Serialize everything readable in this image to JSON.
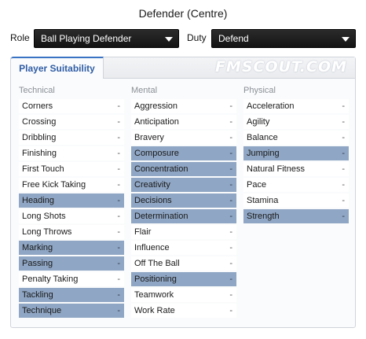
{
  "header": {
    "title": "Defender (Centre)"
  },
  "selectors": {
    "role_label": "Role",
    "role_value": "Ball Playing Defender",
    "duty_label": "Duty",
    "duty_value": "Defend"
  },
  "panel": {
    "tab_label": "Player Suitability",
    "watermark": "FMSCOUT.COM"
  },
  "colors": {
    "highlight": "#8fa6c4",
    "tab_accent": "#3a73c4",
    "select_bg": "#1c1c1c"
  },
  "technical": {
    "heading": "Technical",
    "items": [
      {
        "name": "Corners",
        "value": "-",
        "key": false
      },
      {
        "name": "Crossing",
        "value": "-",
        "key": false
      },
      {
        "name": "Dribbling",
        "value": "-",
        "key": false
      },
      {
        "name": "Finishing",
        "value": "-",
        "key": false
      },
      {
        "name": "First Touch",
        "value": "-",
        "key": false
      },
      {
        "name": "Free Kick Taking",
        "value": "-",
        "key": false
      },
      {
        "name": "Heading",
        "value": "-",
        "key": true
      },
      {
        "name": "Long Shots",
        "value": "-",
        "key": false
      },
      {
        "name": "Long Throws",
        "value": "-",
        "key": false
      },
      {
        "name": "Marking",
        "value": "-",
        "key": true
      },
      {
        "name": "Passing",
        "value": "-",
        "key": true
      },
      {
        "name": "Penalty Taking",
        "value": "-",
        "key": false
      },
      {
        "name": "Tackling",
        "value": "-",
        "key": true
      },
      {
        "name": "Technique",
        "value": "-",
        "key": true
      }
    ]
  },
  "mental": {
    "heading": "Mental",
    "items": [
      {
        "name": "Aggression",
        "value": "-",
        "key": false
      },
      {
        "name": "Anticipation",
        "value": "-",
        "key": false
      },
      {
        "name": "Bravery",
        "value": "-",
        "key": false
      },
      {
        "name": "Composure",
        "value": "-",
        "key": true
      },
      {
        "name": "Concentration",
        "value": "-",
        "key": true
      },
      {
        "name": "Creativity",
        "value": "-",
        "key": true
      },
      {
        "name": "Decisions",
        "value": "-",
        "key": true
      },
      {
        "name": "Determination",
        "value": "-",
        "key": true
      },
      {
        "name": "Flair",
        "value": "-",
        "key": false
      },
      {
        "name": "Influence",
        "value": "-",
        "key": false
      },
      {
        "name": "Off The Ball",
        "value": "-",
        "key": false
      },
      {
        "name": "Positioning",
        "value": "-",
        "key": true
      },
      {
        "name": "Teamwork",
        "value": "-",
        "key": false
      },
      {
        "name": "Work Rate",
        "value": "-",
        "key": false
      }
    ]
  },
  "physical": {
    "heading": "Physical",
    "items": [
      {
        "name": "Acceleration",
        "value": "-",
        "key": false
      },
      {
        "name": "Agility",
        "value": "-",
        "key": false
      },
      {
        "name": "Balance",
        "value": "-",
        "key": false
      },
      {
        "name": "Jumping",
        "value": "-",
        "key": true
      },
      {
        "name": "Natural Fitness",
        "value": "-",
        "key": false
      },
      {
        "name": "Pace",
        "value": "-",
        "key": false
      },
      {
        "name": "Stamina",
        "value": "-",
        "key": false
      },
      {
        "name": "Strength",
        "value": "-",
        "key": true
      }
    ]
  }
}
